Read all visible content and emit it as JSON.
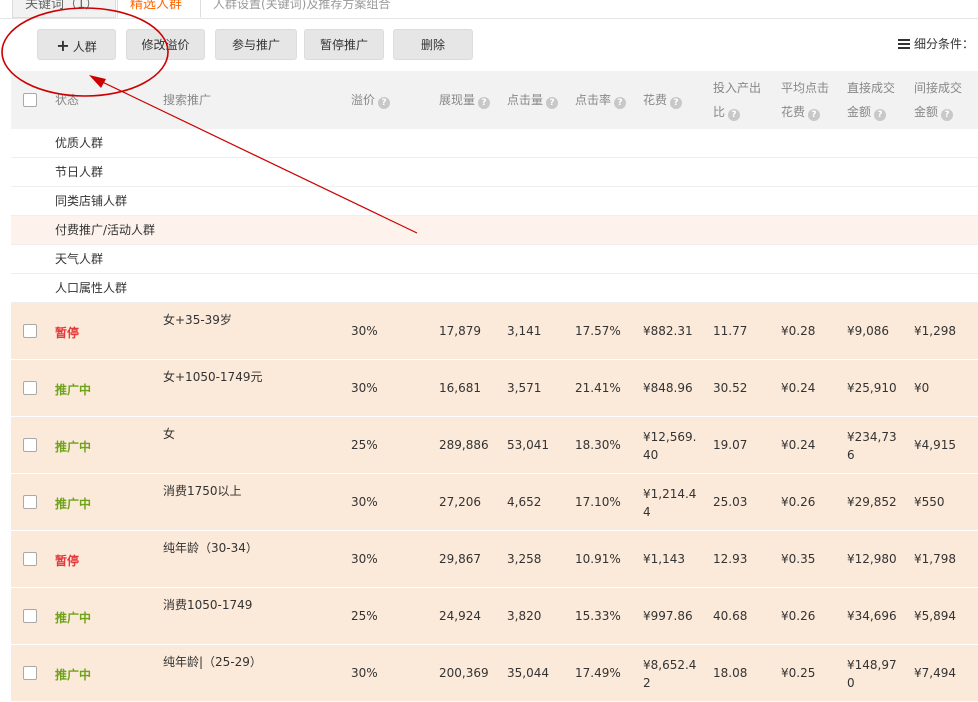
{
  "tabs": [
    {
      "label": "关键词（1）"
    },
    {
      "label": "精选人群"
    },
    {
      "label": "人群设置(关键词)及推荐方案组合"
    }
  ],
  "toolbar": {
    "add_label": "人群",
    "edit_premium_label": "修改溢价",
    "join_label": "参与推广",
    "pause_label": "暂停推广",
    "delete_label": "删除",
    "filter_label": "细分条件："
  },
  "table": {
    "headers": {
      "status": "状态",
      "search": "搜索推广",
      "premium": "溢价",
      "impressions": "展现量",
      "clicks": "点击量",
      "ctr": "点击率",
      "cost": "花费",
      "roi_a": "投入产出",
      "roi_b": "比",
      "cpc_a": "平均点击",
      "cpc_b": "花费",
      "direct_a": "直接成交",
      "direct_b": "金额",
      "indirect_a": "间接成交",
      "indirect_b": "金额"
    },
    "groups": [
      "优质人群",
      "节日人群",
      "同类店铺人群",
      "付费推广/活动人群",
      "天气人群",
      "人口属性人群"
    ],
    "rows": [
      {
        "status": "暂停",
        "name": "女+35-39岁",
        "premium": "30%",
        "impressions": "17,879",
        "clicks": "3,141",
        "ctr": "17.57%",
        "cost_a": "¥882.31",
        "cost_b": "",
        "roi": "11.77",
        "cpc": "¥0.28",
        "direct_a": "¥9,086",
        "direct_b": "",
        "indirect": "¥1,298"
      },
      {
        "status": "推广中",
        "name": "女+1050-1749元",
        "premium": "30%",
        "impressions": "16,681",
        "clicks": "3,571",
        "ctr": "21.41%",
        "cost_a": "¥848.96",
        "cost_b": "",
        "roi": "30.52",
        "cpc": "¥0.24",
        "direct_a": "¥25,910",
        "direct_b": "",
        "indirect": "¥0"
      },
      {
        "status": "推广中",
        "name": "女",
        "premium": "25%",
        "impressions": "289,886",
        "clicks": "53,041",
        "ctr": "18.30%",
        "cost_a": "¥12,569.",
        "cost_b": "40",
        "roi": "19.07",
        "cpc": "¥0.24",
        "direct_a": "¥234,73",
        "direct_b": "6",
        "indirect": "¥4,915"
      },
      {
        "status": "推广中",
        "name": "消费1750以上",
        "premium": "30%",
        "impressions": "27,206",
        "clicks": "4,652",
        "ctr": "17.10%",
        "cost_a": "¥1,214.4",
        "cost_b": "4",
        "roi": "25.03",
        "cpc": "¥0.26",
        "direct_a": "¥29,852",
        "direct_b": "",
        "indirect": "¥550"
      },
      {
        "status": "暂停",
        "name": "纯年龄（30-34）",
        "premium": "30%",
        "impressions": "29,867",
        "clicks": "3,258",
        "ctr": "10.91%",
        "cost_a": "¥1,143",
        "cost_b": "",
        "roi": "12.93",
        "cpc": "¥0.35",
        "direct_a": "¥12,980",
        "direct_b": "",
        "indirect": "¥1,798"
      },
      {
        "status": "推广中",
        "name": "消费1050-1749",
        "premium": "25%",
        "impressions": "24,924",
        "clicks": "3,820",
        "ctr": "15.33%",
        "cost_a": "¥997.86",
        "cost_b": "",
        "roi": "40.68",
        "cpc": "¥0.26",
        "direct_a": "¥34,696",
        "direct_b": "",
        "indirect": "¥5,894"
      },
      {
        "status": "推广中",
        "name": "纯年龄|（25-29）",
        "premium": "30%",
        "impressions": "200,369",
        "clicks": "35,044",
        "ctr": "17.49%",
        "cost_a": "¥8,652.4",
        "cost_b": "2",
        "roi": "18.08",
        "cpc": "¥0.25",
        "direct_a": "¥148,97",
        "direct_b": "0",
        "indirect": "¥7,494"
      }
    ]
  },
  "colors": {
    "paused": "#e4393c",
    "running": "#6ea31a",
    "accent": "#ff6600",
    "annotation": "#cc0000"
  }
}
